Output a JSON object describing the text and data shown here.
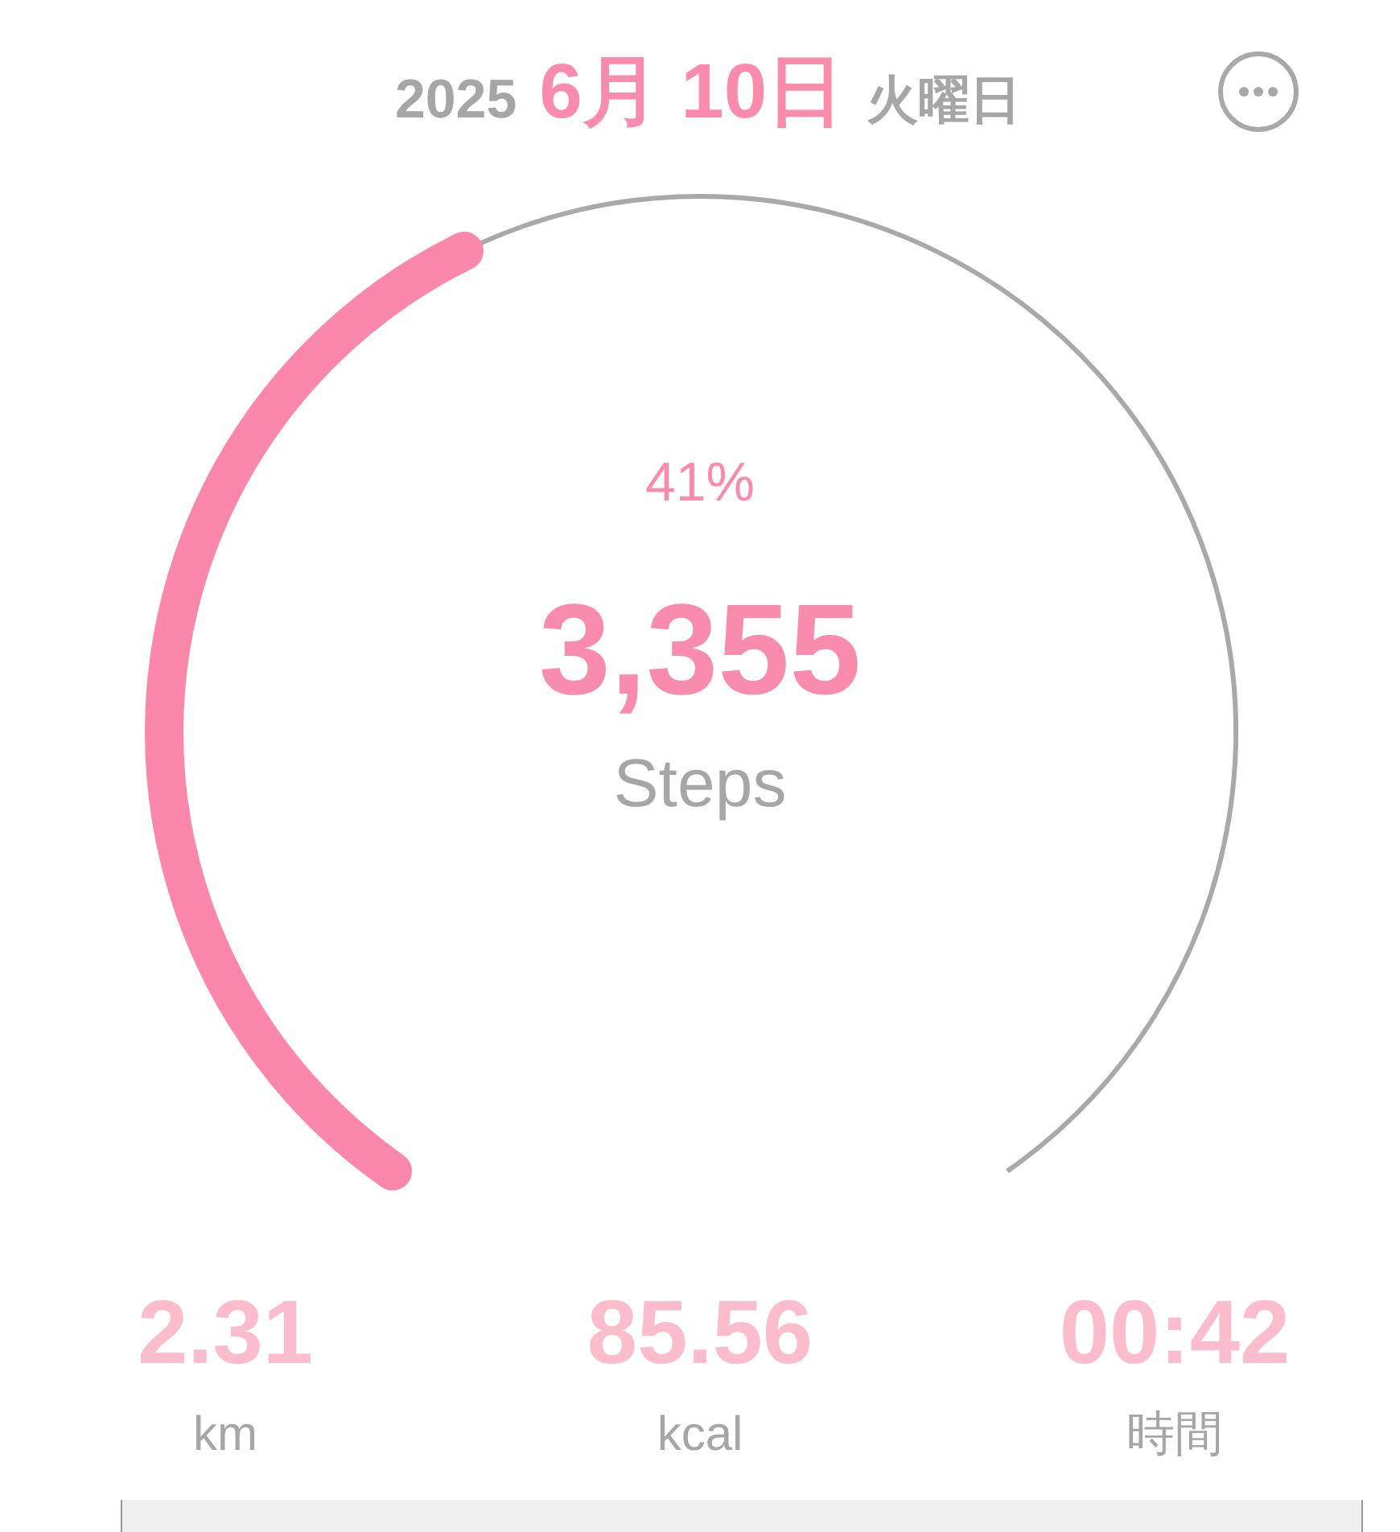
{
  "header": {
    "year": "2025",
    "date": "6月 10日",
    "weekday": "火曜日"
  },
  "progress": {
    "percent": "41%",
    "steps": "3,355",
    "unit": "Steps"
  },
  "stats": [
    {
      "value": "2.31",
      "unit": "km"
    },
    {
      "value": "85.56",
      "unit": "kcal"
    },
    {
      "value": "00:42",
      "unit": "時間"
    }
  ]
}
